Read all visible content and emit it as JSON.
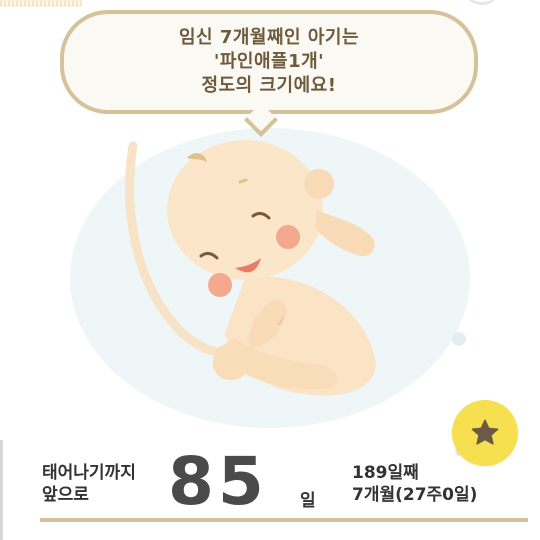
{
  "speech_bubble": {
    "line1": "임신 7개월째인 아기는",
    "line2": "'파인애플1개'",
    "line3": "정도의 크기에요!"
  },
  "countdown": {
    "label_line1": "태어나기까지",
    "label_line2": "앞으로",
    "days": "85",
    "unit": "일"
  },
  "pregnancy_info": {
    "day_count": "189일째",
    "month_week": "7개월(27주0일)"
  },
  "colors": {
    "bubble_border": "#d5c29a",
    "accent_underline": "#d3c19e",
    "favorite_button": "#f7e04f",
    "star_icon": "#6b5a45",
    "womb": "#eff6f8"
  },
  "icons": {
    "favorite": "star-icon",
    "illustration": "baby-illustration"
  }
}
